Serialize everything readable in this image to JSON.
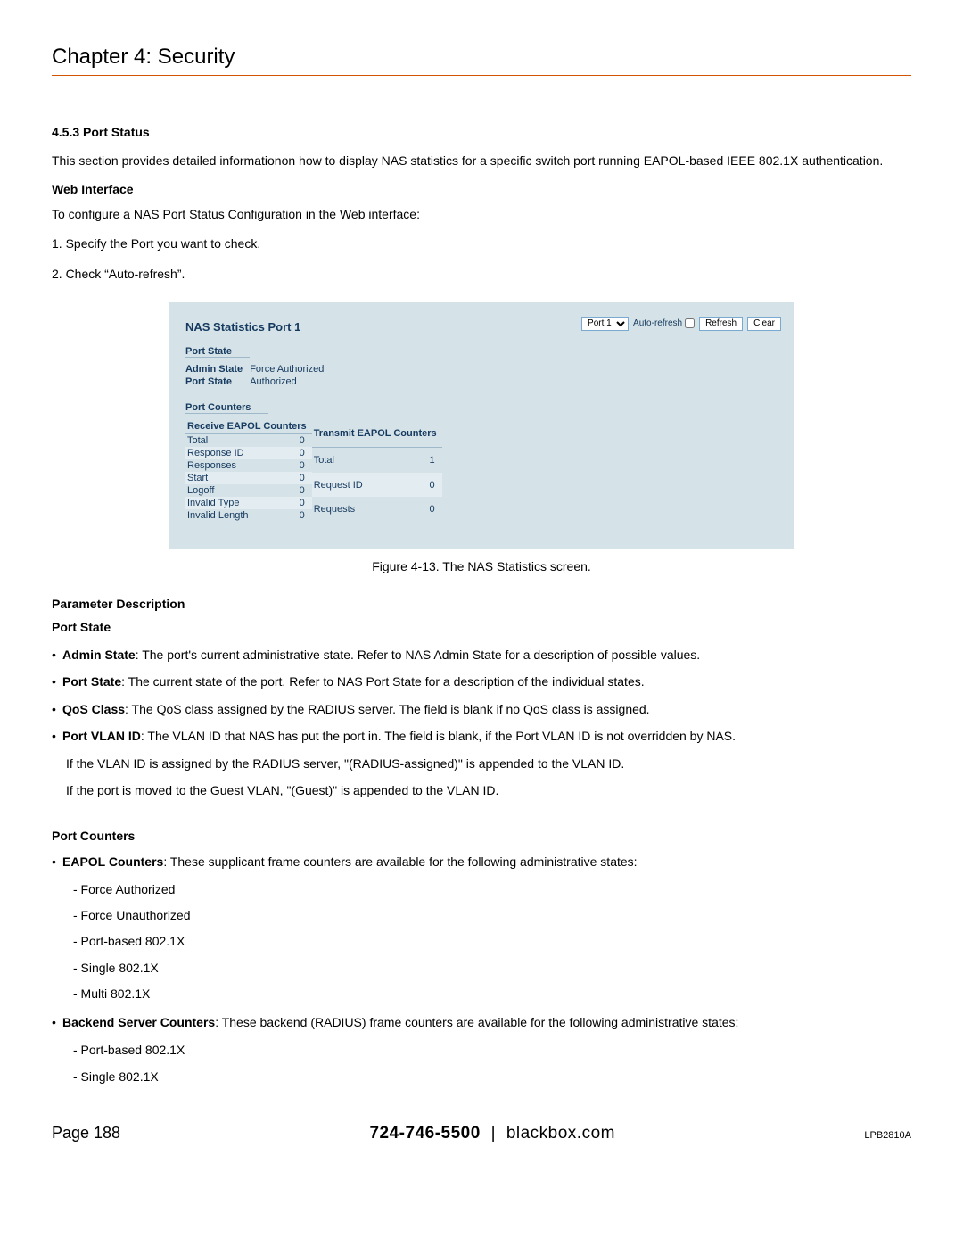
{
  "chapter_title": "Chapter 4: Security",
  "section_number": "4.5.3 Port Status",
  "intro": "This section provides detailed informationon how to display NAS statistics for a specific switch port running EAPOL-based IEEE 802.1X authentication.",
  "web_interface_head": "Web Interface",
  "web_interface_line": "To configure a NAS Port Status Configuration in the Web interface:",
  "steps": [
    "1. Specify the Port you want to check.",
    "2. Check “Auto-refresh”."
  ],
  "figure": {
    "nas_title": "NAS Statistics Port 1",
    "port_selector_label": "Port 1",
    "auto_refresh_label": "Auto-refresh",
    "refresh_btn": "Refresh",
    "clear_btn": "Clear",
    "port_state_head": "Port State",
    "admin_state_label": "Admin State",
    "admin_state_value": "Force Authorized",
    "port_state_label": "Port State",
    "port_state_value": "Authorized",
    "port_counters_head": "Port Counters",
    "recv_head": "Receive EAPOL Counters",
    "tx_head": "Transmit EAPOL Counters",
    "recv_rows": [
      {
        "label": "Total",
        "value": "0"
      },
      {
        "label": "Response ID",
        "value": "0"
      },
      {
        "label": "Responses",
        "value": "0"
      },
      {
        "label": "Start",
        "value": "0"
      },
      {
        "label": "Logoff",
        "value": "0"
      },
      {
        "label": "Invalid Type",
        "value": "0"
      },
      {
        "label": "Invalid Length",
        "value": "0"
      }
    ],
    "tx_rows": [
      {
        "label": "Total",
        "value": "1"
      },
      {
        "label": "Request ID",
        "value": "0"
      },
      {
        "label": "Requests",
        "value": "0"
      }
    ]
  },
  "figure_caption": "Figure 4-13. The NAS Statistics screen.",
  "param_desc_head": "Parameter Description",
  "port_state_param_head": "Port State",
  "bullets_port_state": [
    {
      "bold": "Admin State",
      "rest": ": The port's current administrative state. Refer to NAS Admin State for a description of possible values."
    },
    {
      "bold": "Port State",
      "rest": ": The current state of the port. Refer to NAS Port State for a description of the individual states."
    },
    {
      "bold": "QoS Class",
      "rest": ": The QoS class assigned by the RADIUS server. The field is blank if no QoS class is assigned."
    },
    {
      "bold": "Port VLAN ID",
      "rest": ": The VLAN ID that NAS has put the port in. The field is blank, if the Port VLAN ID is not overridden by NAS."
    }
  ],
  "vlan_sub": [
    "If the VLAN ID is assigned by the RADIUS server, \"(RADIUS-assigned)\" is appended to the VLAN ID.",
    "If the port is moved to the Guest VLAN, \"(Guest)\" is appended to the VLAN ID."
  ],
  "port_counters_head": "Port Counters",
  "eapol_bullet_bold": "EAPOL Counters",
  "eapol_bullet_rest": ": These supplicant frame counters are available for the following administrative states:",
  "eapol_list": [
    "- Force Authorized",
    "- Force Unauthorized",
    "- Port-based 802.1X",
    "- Single 802.1X",
    "- Multi 802.1X"
  ],
  "backend_bullet_bold": "Backend Server Counters",
  "backend_bullet_rest": ": These backend (RADIUS) frame counters are available for the following administrative states:",
  "backend_list": [
    "- Port-based 802.1X",
    "- Single 802.1X"
  ],
  "footer": {
    "page": "Page 188",
    "phone": "724-746-5500",
    "site": "blackbox.com",
    "model": "LPB2810A"
  }
}
